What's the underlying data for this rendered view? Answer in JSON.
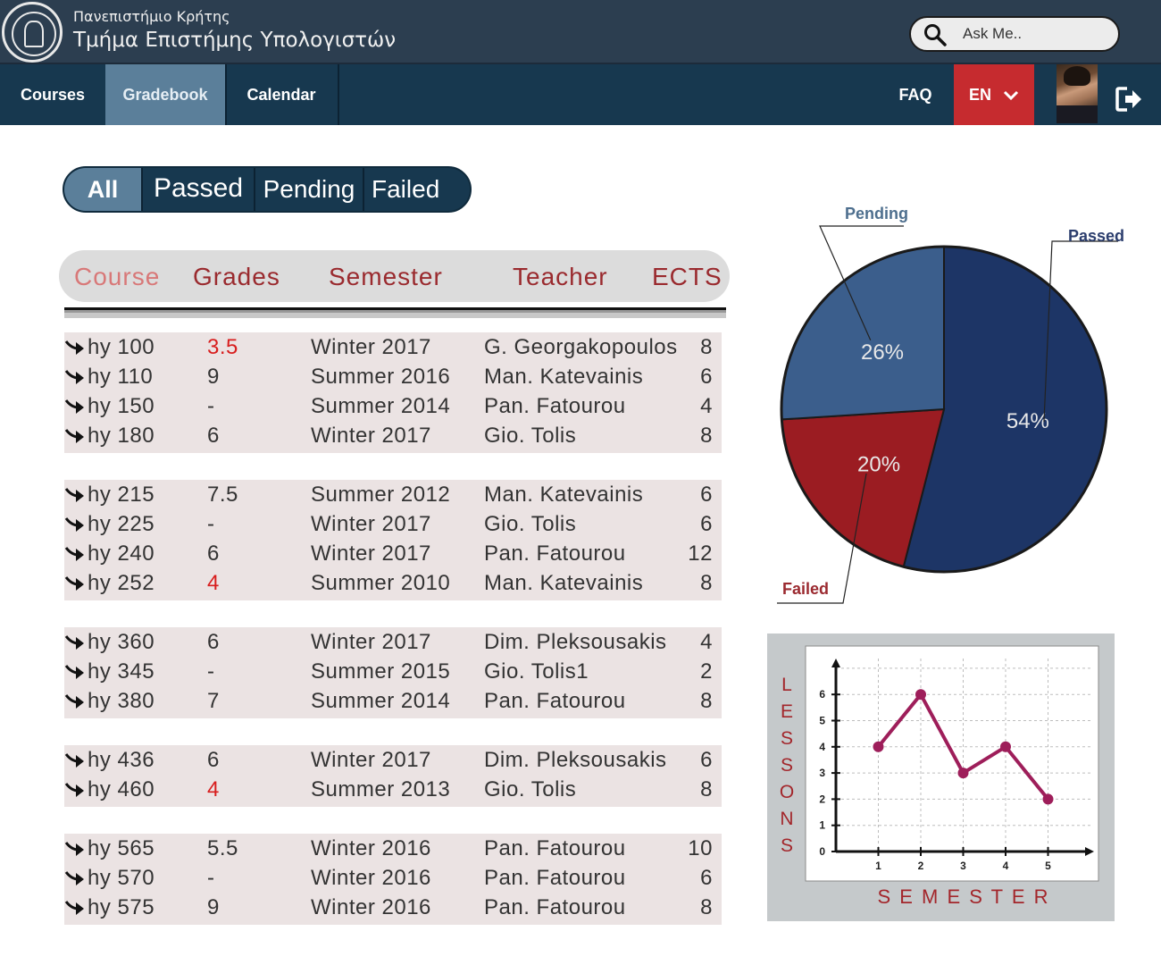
{
  "header": {
    "university": "Πανεπιστήμιο Κρήτης",
    "department": "Τμήμα Επιστήμης Υπολογιστών",
    "search_placeholder": "Ask Me.."
  },
  "nav": {
    "courses": "Courses",
    "gradebook": "Gradebook",
    "calendar": "Calendar",
    "faq": "FAQ",
    "language": "EN"
  },
  "filters": {
    "all": "All",
    "passed": "Passed",
    "pending": "Pending",
    "failed": "Failed",
    "active": "All"
  },
  "table": {
    "headers": {
      "course": "Course",
      "grades": "Grades",
      "semester": "Semester",
      "teacher": "Teacher",
      "ects": "ECTS"
    },
    "groups": [
      [
        {
          "course": "hy 100",
          "grade": "3.5",
          "grade_failed": true,
          "semester": "Winter 2017",
          "teacher": "G. Georgakopoulos",
          "ects": "8"
        },
        {
          "course": "hy 110",
          "grade": "9",
          "grade_failed": false,
          "semester": "Summer 2016",
          "teacher": "Man. Katevainis",
          "ects": "6"
        },
        {
          "course": "hy 150",
          "grade": "-",
          "grade_failed": false,
          "semester": "Summer 2014",
          "teacher": "Pan. Fatourou",
          "ects": "4"
        },
        {
          "course": "hy 180",
          "grade": "6",
          "grade_failed": false,
          "semester": "Winter 2017",
          "teacher": "Gio. Tolis",
          "ects": "8"
        }
      ],
      [
        {
          "course": "hy 215",
          "grade": "7.5",
          "grade_failed": false,
          "semester": "Summer 2012",
          "teacher": "Man. Katevainis",
          "ects": "6"
        },
        {
          "course": "hy 225",
          "grade": "-",
          "grade_failed": false,
          "semester": "Winter 2017",
          "teacher": "Gio. Tolis",
          "ects": "6"
        },
        {
          "course": "hy 240",
          "grade": "6",
          "grade_failed": false,
          "semester": "Winter 2017",
          "teacher": "Pan. Fatourou",
          "ects": "12"
        },
        {
          "course": "hy 252",
          "grade": "4",
          "grade_failed": true,
          "semester": "Summer  2010",
          "teacher": "Man. Katevainis",
          "ects": "8"
        }
      ],
      [
        {
          "course": "hy 360",
          "grade": "6",
          "grade_failed": false,
          "semester": "Winter 2017",
          "teacher": "Dim. Pleksousakis",
          "ects": "4"
        },
        {
          "course": "hy 345",
          "grade": "-",
          "grade_failed": false,
          "semester": "Summer  2015",
          "teacher": "Gio. Tolis1",
          "ects": "2"
        },
        {
          "course": "hy 380",
          "grade": "7",
          "grade_failed": false,
          "semester": "Summer  2014",
          "teacher": "Pan. Fatourou",
          "ects": "8"
        }
      ],
      [
        {
          "course": "hy 436",
          "grade": "6",
          "grade_failed": false,
          "semester": "Winter 2017",
          "teacher": "Dim. Pleksousakis",
          "ects": "6"
        },
        {
          "course": "hy 460",
          "grade": "4",
          "grade_failed": true,
          "semester": "Summer 2013",
          "teacher": "Gio. Tolis",
          "ects": "8"
        }
      ],
      [
        {
          "course": "hy 565",
          "grade": "5.5",
          "grade_failed": false,
          "semester": "Winter 2016",
          "teacher": "Pan. Fatourou",
          "ects": "10"
        },
        {
          "course": "hy 570",
          "grade": "-",
          "grade_failed": false,
          "semester": "Winter 2016",
          "teacher": "Pan. Fatourou",
          "ects": "6"
        },
        {
          "course": "hy 575",
          "grade": "9",
          "grade_failed": false,
          "semester": "Winter 2016",
          "teacher": "Pan. Fatourou",
          "ects": "8"
        }
      ]
    ]
  },
  "chart_data": [
    {
      "type": "pie",
      "slices": [
        {
          "name": "Passed",
          "value": 54,
          "label": "54%",
          "color": "#1d3566"
        },
        {
          "name": "Failed",
          "value": 20,
          "label": "20%",
          "color": "#9b1c22"
        },
        {
          "name": "Pending",
          "value": 26,
          "label": "26%",
          "color": "#3b5e8c"
        }
      ],
      "legend_colors": {
        "Passed": "#2c3e6e",
        "Pending": "#4e6f8e",
        "Failed": "#9b2a30"
      }
    },
    {
      "type": "line",
      "x": [
        1,
        2,
        3,
        4,
        5
      ],
      "y": [
        4,
        6,
        3,
        4,
        2
      ],
      "xticks": [
        "1",
        "2",
        "3",
        "4",
        "5"
      ],
      "yticks": [
        "0",
        "1",
        "2",
        "3",
        "4",
        "5",
        "6"
      ],
      "xlabel": "S E M E S T E R",
      "ylabel": "LESSONS",
      "xlim": [
        0,
        5.8
      ],
      "ylim": [
        0,
        7.2
      ],
      "grid": true,
      "line_color": "#9e1e5a",
      "label_color": "#a3262b"
    }
  ]
}
